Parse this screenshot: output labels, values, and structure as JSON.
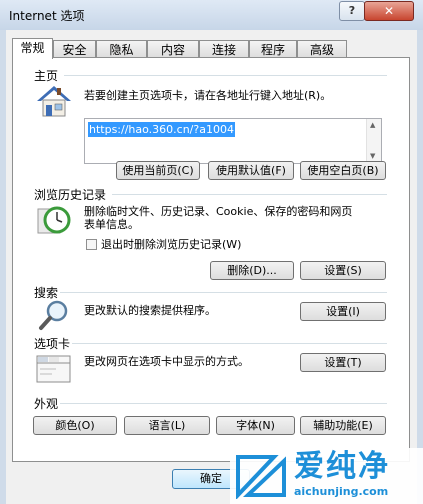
{
  "window": {
    "title": "Internet 选项",
    "help_label": "?",
    "close_label": "✕"
  },
  "tabs": [
    {
      "label": "常规",
      "active": true
    },
    {
      "label": "安全"
    },
    {
      "label": "隐私"
    },
    {
      "label": "内容"
    },
    {
      "label": "连接"
    },
    {
      "label": "程序"
    },
    {
      "label": "高级"
    }
  ],
  "homepage": {
    "title": "主页",
    "description": "若要创建主页选项卡，请在各地址行键入地址(R)。",
    "url": "https://hao.360.cn/?a1004",
    "buttons": [
      "使用当前页(C)",
      "使用默认值(F)",
      "使用空白页(B)"
    ],
    "icon": "house-icon"
  },
  "history": {
    "title": "浏览历史记录",
    "description_line1": "删除临时文件、历史记录、Cookie、保存的密码和网页",
    "description_line2": "表单信息。",
    "checkbox_label": "退出时删除浏览历史记录(W)",
    "checkbox_checked": false,
    "delete_button": "删除(D)...",
    "settings_button": "设置(S)",
    "icon": "history-clock-icon"
  },
  "search": {
    "title": "搜索",
    "description": "更改默认的搜索提供程序。",
    "settings_button": "设置(I)",
    "icon": "magnifier-icon"
  },
  "tabs_section": {
    "title": "选项卡",
    "description": "更改网页在选项卡中显示的方式。",
    "settings_button": "设置(T)",
    "icon": "tab-window-icon"
  },
  "appearance": {
    "title": "外观",
    "buttons": [
      "颜色(O)",
      "语言(L)",
      "字体(N)",
      "辅助功能(E)"
    ]
  },
  "footer": {
    "ok_button": "确定"
  },
  "watermark": {
    "brand": "爱纯净",
    "url": "aichunjing.com",
    "color": "#1d8fd8"
  }
}
